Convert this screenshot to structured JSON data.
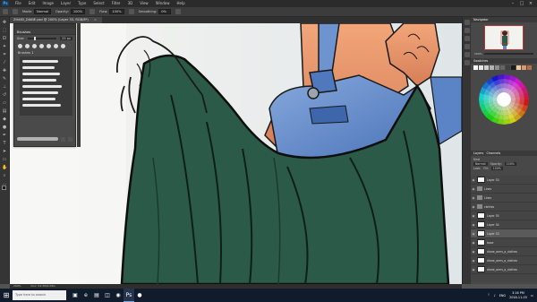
{
  "menubar": {
    "logo": "Ps",
    "items": [
      "File",
      "Edit",
      "Image",
      "Layer",
      "Type",
      "Select",
      "Filter",
      "3D",
      "View",
      "Window",
      "Help"
    ]
  },
  "options": {
    "mode_label": "Mode:",
    "mode_value": "Normal",
    "opacity_label": "Opacity:",
    "opacity_value": "100%",
    "flow_label": "Flow:",
    "flow_value": "100%",
    "smoothing_label": "Smoothing:",
    "smoothing_value": "0%"
  },
  "document_tab": {
    "title": "ZH485_DIANE.psd @ 200% (Layer 33, RGB/8*)",
    "close": "×"
  },
  "brush_panel": {
    "title": "Brushes",
    "size_label": "Size:",
    "size_value": "25 px",
    "group_label": "Brushes 1"
  },
  "navigator": {
    "title": "Navigator",
    "zoom": "200%"
  },
  "swatches": {
    "title": "Swatches",
    "colors": [
      "#ffffff",
      "#e6e6e6",
      "#cfcfcf",
      "#b3b3b3",
      "#8c8c8c",
      "#666666",
      "#404040",
      "#1a1a1a",
      "#f0c8a0",
      "#d99a6c",
      "#b86e48"
    ]
  },
  "layers_panel": {
    "title": "Layers",
    "channels_tab": "Channels",
    "kind_label": "Kind",
    "blend_value": "Normal",
    "opacity_label": "Opacity:",
    "opacity_value": "100%",
    "lock_label": "Lock:",
    "fill_label": "Fill:",
    "fill_value": "100%",
    "layers": [
      {
        "name": "Layer 33",
        "type": "layer",
        "selected": false
      },
      {
        "name": "Lines",
        "type": "folder",
        "selected": false
      },
      {
        "name": "Lines",
        "type": "folder",
        "selected": false
      },
      {
        "name": "clothes",
        "type": "folder",
        "selected": false
      },
      {
        "name": "Layer 35",
        "type": "layer",
        "selected": false
      },
      {
        "name": "Layer 34",
        "type": "layer",
        "selected": false
      },
      {
        "name": "Layer 33",
        "type": "layer",
        "selected": true
      },
      {
        "name": "base",
        "type": "layer",
        "selected": false
      },
      {
        "name": "diane_arms_a_clothes",
        "type": "layer",
        "selected": false
      },
      {
        "name": "diane_arms_a_clothes",
        "type": "layer",
        "selected": false
      },
      {
        "name": "diane_arms_a_clothes",
        "type": "layer",
        "selected": false
      }
    ]
  },
  "status": {
    "zoom": "200%",
    "doc": "Doc: 54.3M/2.05G"
  },
  "taskbar": {
    "search_placeholder": "Type here to search",
    "time": "3:16 PM",
    "date": "2018-11-03",
    "lang": "ENG"
  },
  "colors": {
    "dress_green": "#2c5a48",
    "skin": "#e8946a",
    "denim": "#5d86c8"
  }
}
